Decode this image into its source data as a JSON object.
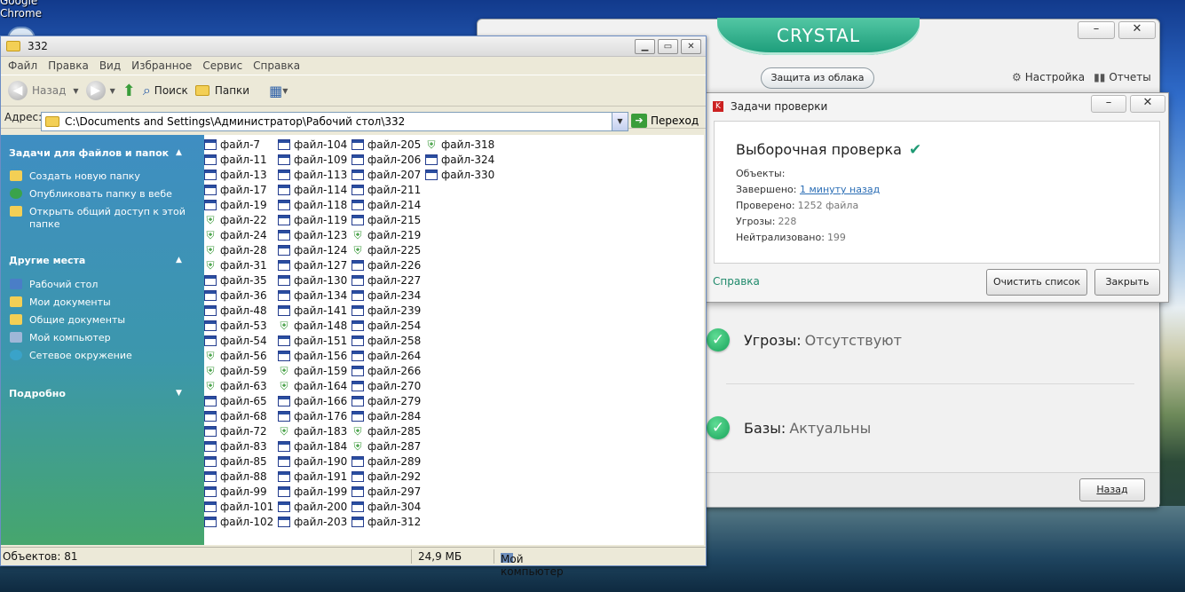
{
  "desktop": {
    "chrome_label": "Google\nChrome"
  },
  "kaspersky": {
    "brand": "CRYSTAL",
    "cloud_button": "Защита из облака",
    "settings_label": "Настройка",
    "reports_label": "Отчеты",
    "status": [
      {
        "label": "Угрозы:",
        "value": "Отсутствуют"
      },
      {
        "label": "Базы:",
        "value": "Актуальны"
      }
    ],
    "back_button": "Назад"
  },
  "dialog": {
    "title": "Задачи проверки",
    "heading": "Выборочная проверка",
    "objects_label": "Объекты:",
    "completed_label": "Завершено:",
    "completed_value": "1 минуту назад",
    "checked_label": "Проверено:",
    "checked_value": "1252 файла",
    "threats_label": "Угрозы:",
    "threats_value": "228",
    "neutralized_label": "Нейтрализовано:",
    "neutralized_value": "199",
    "help_link": "Справка",
    "clear_button": "Очистить список",
    "close_button": "Закрыть"
  },
  "explorer": {
    "title": "332",
    "menu": [
      "Файл",
      "Правка",
      "Вид",
      "Избранное",
      "Сервис",
      "Справка"
    ],
    "toolbar": {
      "back": "Назад",
      "search": "Поиск",
      "folders": "Папки"
    },
    "address_label": "Адрес:",
    "address_value": "C:\\Documents and Settings\\Администратор\\Рабочий стол\\332",
    "go_label": "Переход",
    "sidebar": {
      "tasks_header": "Задачи для файлов и папок",
      "tasks": [
        "Создать новую папку",
        "Опубликовать папку в вебе",
        "Открыть общий доступ к этой папке"
      ],
      "places_header": "Другие места",
      "places": [
        "Рабочий стол",
        "Мои документы",
        "Общие документы",
        "Мой компьютер",
        "Сетевое окружение"
      ],
      "details_header": "Подробно"
    },
    "files": [
      [
        "файл-7",
        "файл-11",
        "файл-13",
        "файл-17",
        "файл-19",
        "файл-22",
        "файл-24",
        "файл-28",
        "файл-31",
        "файл-35",
        "файл-36",
        "файл-48",
        "файл-53",
        "файл-54",
        "файл-56",
        "файл-59",
        "файл-63",
        "файл-65",
        "файл-68",
        "файл-72",
        "файл-83",
        "файл-85",
        "файл-88",
        "файл-99",
        "файл-101",
        "файл-102"
      ],
      [
        "файл-104",
        "файл-109",
        "файл-113",
        "файл-114",
        "файл-118",
        "файл-119",
        "файл-123",
        "файл-124",
        "файл-127",
        "файл-130",
        "файл-134",
        "файл-141",
        "файл-148",
        "файл-151",
        "файл-156",
        "файл-159",
        "файл-164",
        "файл-166",
        "файл-176",
        "файл-183",
        "файл-184",
        "файл-190",
        "файл-191",
        "файл-199",
        "файл-200",
        "файл-203"
      ],
      [
        "файл-205",
        "файл-206",
        "файл-207",
        "файл-211",
        "файл-214",
        "файл-215",
        "файл-219",
        "файл-225",
        "файл-226",
        "файл-227",
        "файл-234",
        "файл-239",
        "файл-254",
        "файл-258",
        "файл-264",
        "файл-266",
        "файл-270",
        "файл-279",
        "файл-284",
        "файл-285",
        "файл-287",
        "файл-289",
        "файл-292",
        "файл-297",
        "файл-304",
        "файл-312"
      ],
      [
        "файл-318",
        "файл-324",
        "файл-330"
      ]
    ],
    "status": {
      "objects": "Объектов: 81",
      "size": "24,9 МБ",
      "location": "Мой компьютер"
    }
  }
}
